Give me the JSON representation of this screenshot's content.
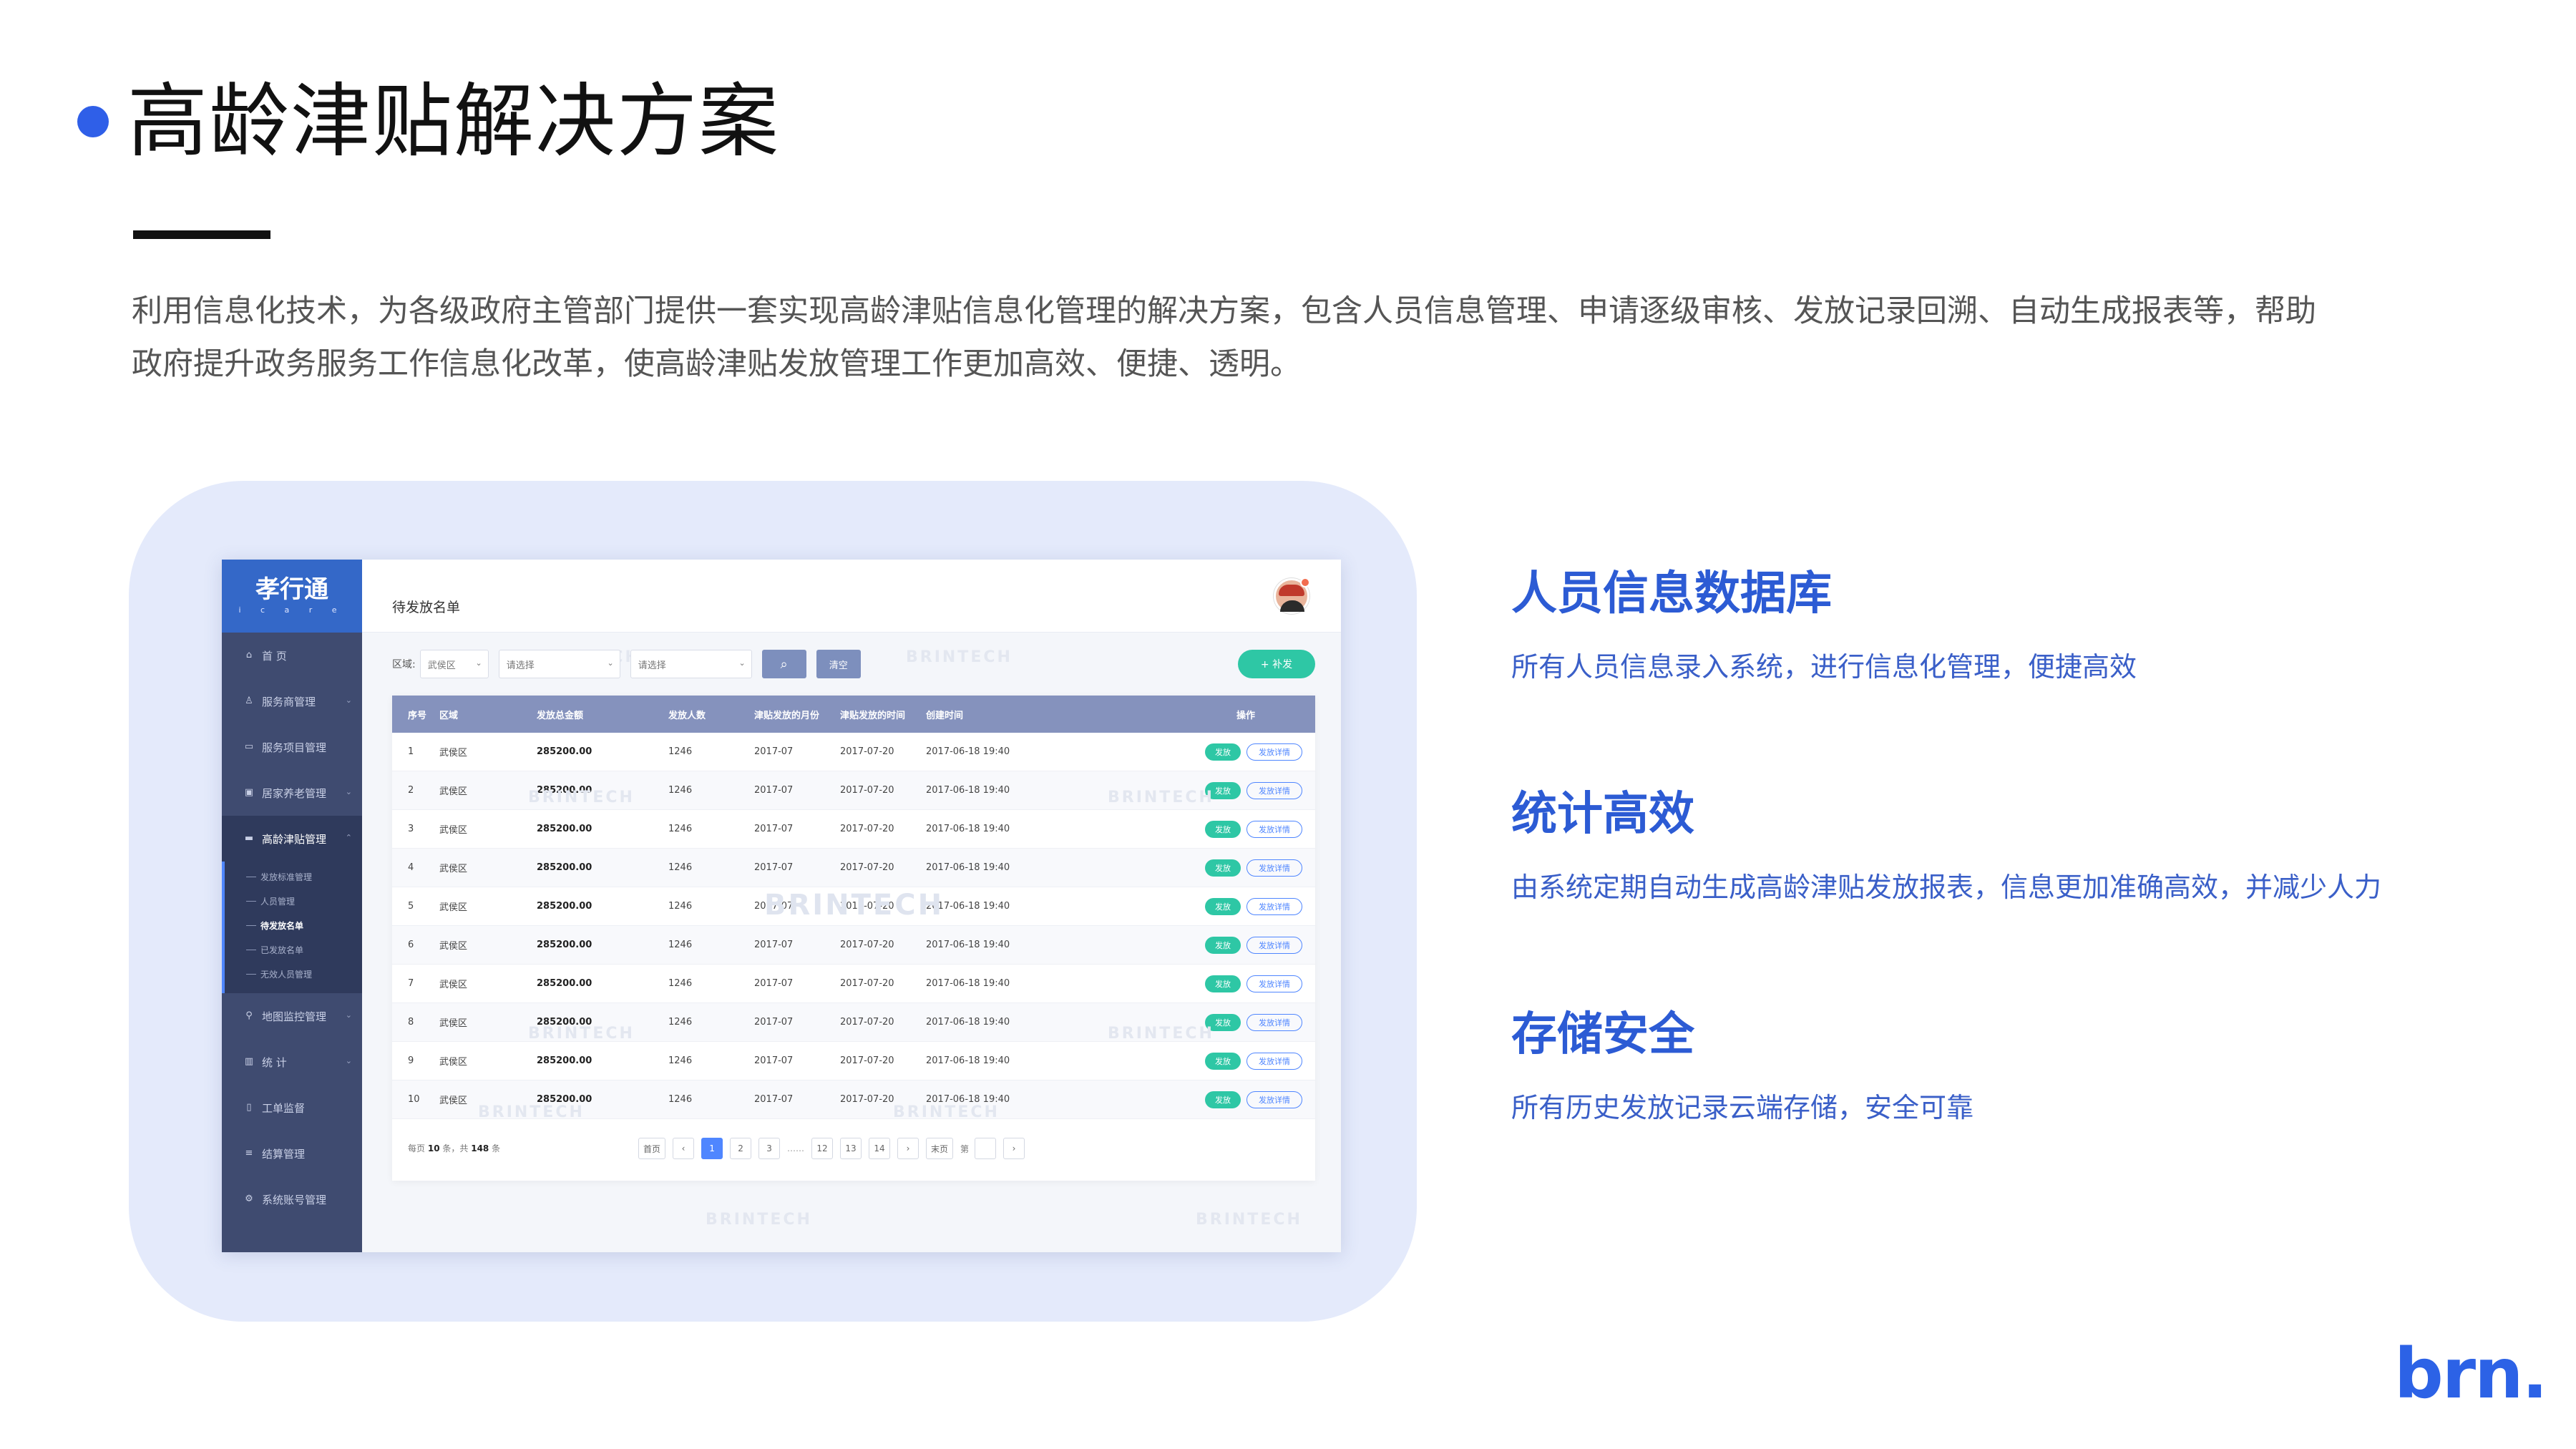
{
  "slide": {
    "title": "高龄津贴解决方案",
    "intro": "利用信息化技术，为各级政府主管部门提供一套实现高龄津贴信息化管理的解决方案，包含人员信息管理、申请逐级审核、发放记录回溯、自动生成报表等，帮助政府提升政务服务工作信息化改革，使高龄津贴发放管理工作更加高效、便捷、透明。",
    "brand": "brn.",
    "accent_color": "#2c5bd4"
  },
  "features": [
    {
      "title": "人员信息数据库",
      "desc": "所有人员信息录入系统，进行信息化管理，便捷高效"
    },
    {
      "title": "统计高效",
      "desc": "由系统定期自动生成高龄津贴发放报表，信息更加准确高效，并减少人力"
    },
    {
      "title": "存储安全",
      "desc": "所有历史发放记录云端存储，安全可靠"
    }
  ],
  "app": {
    "logo": "孝行通",
    "logo_sub": "i c a r e",
    "page_title": "待发放名单",
    "watermark": "BRINTECH",
    "sidebar": {
      "items": [
        {
          "label": "首 页",
          "icon": "home-icon"
        },
        {
          "label": "服务商管理",
          "icon": "user-icon"
        },
        {
          "label": "服务项目管理",
          "icon": "folder-icon"
        },
        {
          "label": "居家养老管理",
          "icon": "card-icon"
        },
        {
          "label": "高龄津贴管理",
          "icon": "wallet-icon"
        },
        {
          "label": "地图监控管理",
          "icon": "map-pin-icon"
        },
        {
          "label": "统 计",
          "icon": "bar-chart-icon"
        },
        {
          "label": "工单监督",
          "icon": "document-icon"
        },
        {
          "label": "结算管理",
          "icon": "list-icon"
        },
        {
          "label": "系统账号管理",
          "icon": "gear-icon"
        }
      ],
      "subitems": [
        "发放标准管理",
        "人员管理",
        "待发放名单",
        "已发放名单",
        "无效人员管理"
      ]
    },
    "filter": {
      "label": "区域:",
      "area_value": "武侯区",
      "select2": "请选择",
      "select3": "请选择",
      "clear": "清空",
      "add": "+ 补发"
    },
    "table": {
      "headers": [
        "序号",
        "区域",
        "发放总金额",
        "发放人数",
        "津贴发放的月份",
        "津贴发放的时间",
        "创建时间",
        "操作"
      ],
      "rows": [
        [
          "1",
          "武侯区",
          "285200.00",
          "1246",
          "2017-07",
          "2017-07-20",
          "2017-06-18 19:40"
        ],
        [
          "2",
          "武侯区",
          "285200.00",
          "1246",
          "2017-07",
          "2017-07-20",
          "2017-06-18 19:40"
        ],
        [
          "3",
          "武侯区",
          "285200.00",
          "1246",
          "2017-07",
          "2017-07-20",
          "2017-06-18 19:40"
        ],
        [
          "4",
          "武侯区",
          "285200.00",
          "1246",
          "2017-07",
          "2017-07-20",
          "2017-06-18 19:40"
        ],
        [
          "5",
          "武侯区",
          "285200.00",
          "1246",
          "2017-07",
          "2017-07-20",
          "2017-06-18 19:40"
        ],
        [
          "6",
          "武侯区",
          "285200.00",
          "1246",
          "2017-07",
          "2017-07-20",
          "2017-06-18 19:40"
        ],
        [
          "7",
          "武侯区",
          "285200.00",
          "1246",
          "2017-07",
          "2017-07-20",
          "2017-06-18 19:40"
        ],
        [
          "8",
          "武侯区",
          "285200.00",
          "1246",
          "2017-07",
          "2017-07-20",
          "2017-06-18 19:40"
        ],
        [
          "9",
          "武侯区",
          "285200.00",
          "1246",
          "2017-07",
          "2017-07-20",
          "2017-06-18 19:40"
        ],
        [
          "10",
          "武侯区",
          "285200.00",
          "1246",
          "2017-07",
          "2017-07-20",
          "2017-06-18 19:40"
        ]
      ],
      "action_primary": "发放",
      "action_secondary": "发放详情"
    },
    "pager": {
      "per_page_prefix": "每页",
      "per_page": "10",
      "per_page_unit": "条，共",
      "total": "148",
      "total_unit": "条",
      "first": "首页",
      "last": "末页",
      "prev": "‹",
      "next": "›",
      "pages_a": [
        "1",
        "2",
        "3"
      ],
      "ellipsis": "……",
      "pages_b": [
        "12",
        "13",
        "14"
      ],
      "jump_label": "第",
      "current": "1"
    }
  }
}
